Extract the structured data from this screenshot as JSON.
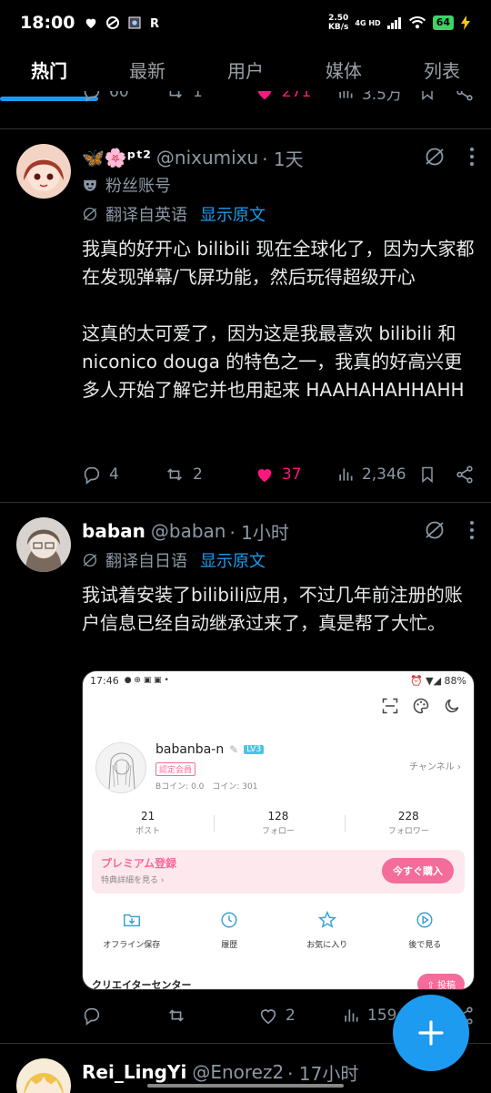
{
  "status_bar": {
    "time": "18:00",
    "net_speed_value": "2.50",
    "net_speed_unit": "KB/s",
    "network": "4G HD",
    "battery": "64"
  },
  "tabs": [
    {
      "label": "热门"
    },
    {
      "label": "最新"
    },
    {
      "label": "用户"
    },
    {
      "label": "媒体"
    },
    {
      "label": "列表"
    }
  ],
  "top_partial": {
    "replies": "60",
    "reposts": "1",
    "likes": "271",
    "views": "3.5万"
  },
  "posts": [
    {
      "display_name": "🦋🌸ᵖᵗ²",
      "handle": "@nixumixu",
      "time": "· 1天",
      "account_label": "粉丝账号",
      "translated_from": "翻译自英语",
      "show_original": "显示原文",
      "text": "我真的好开心 bilibili 现在全球化了，因为大家都在发现弹幕/飞屏功能，然后玩得超级开心\n\n这真的太可爱了，因为这是我最喜欢 bilibili 和 niconico douga 的特色之一，我真的好高兴更多人开始了解它并也用起来 HAAHAHAHHAHH",
      "replies": "4",
      "reposts": "2",
      "likes": "37",
      "views": "2,346"
    },
    {
      "display_name": "baban",
      "handle": "@baban",
      "time": "· 1小时",
      "translated_from": "翻译自日语",
      "show_original": "显示原文",
      "text": "我试着安装了bilibili应用，不过几年前注册的账户信息已经自动继承过来了，真是帮了大忙。",
      "replies": "",
      "reposts": "",
      "likes": "2",
      "views": "159",
      "embedded_screenshot": {
        "time": "17:46",
        "battery": "88%",
        "username": "babanba-n",
        "level": "LV3",
        "badge": "認定会員",
        "coins": "Bコイン: 0.0　コイン: 301",
        "channel": "チャンネル ›",
        "stats": [
          {
            "n": "21",
            "l": "ポスト"
          },
          {
            "n": "128",
            "l": "フォロー"
          },
          {
            "n": "228",
            "l": "フォロワー"
          }
        ],
        "premium_title": "プレミアム登録",
        "premium_sub": "特典詳細を見る ›",
        "premium_button": "今すぐ購入",
        "features": [
          {
            "label": "オフライン保存"
          },
          {
            "label": "履歴"
          },
          {
            "label": "お気に入り"
          },
          {
            "label": "後で見る"
          }
        ],
        "creator_center": "クリエイターセンター",
        "post_button": "投稿"
      }
    },
    {
      "display_name": "Rei_LingYi",
      "handle": "@Enorez2",
      "time": "· 17小时"
    }
  ],
  "colors": {
    "accent": "#1d9bf0",
    "like": "#f91880",
    "muted": "#8b98a5"
  }
}
